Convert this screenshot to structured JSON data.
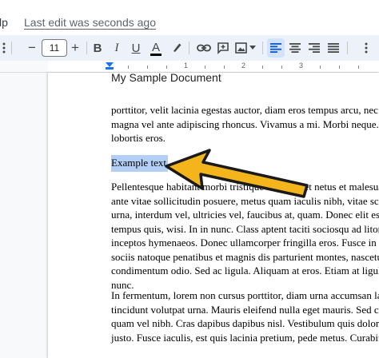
{
  "menu": {
    "help_fragment": "lp",
    "last_edit": "Last edit was seconds ago"
  },
  "toolbar": {
    "font_size": "11",
    "minus": "−",
    "plus": "+",
    "bold": "B",
    "italic": "I",
    "underline": "U",
    "text_color": "A"
  },
  "ruler": {
    "numbers": [
      "1",
      "2",
      "3"
    ]
  },
  "document": {
    "title": "My Sample Document",
    "paragraph1": [
      "porttitor, velit lacinia egestas auctor, diam eros tempus arcu, nec v",
      "magna vel ante adipiscing rhoncus. Vivamus a mi. Morbi neque. A",
      "lobortis eros."
    ],
    "selected_text": "Example text",
    "paragraph2": [
      "Pellentesque habitant morbi tristique senectus et netus et malesua",
      "ante vitae sollicitudin posuere, metus quam iaculis nibh, vitae scel",
      "urna, interdum vel, ultricies vel, faucibus at, quam. Donec elit est,",
      "tempus quis, wisi. In in nunc. Class aptent taciti sociosqu ad litora",
      "inceptos hymenaeos. Donec ullamcorper fringilla eros. Fusce in sa",
      "sociis natoque penatibus et magnis dis parturient montes, nascetur",
      "condimentum odio. Sed ac ligula. Aliquam at eros. Etiam at ligula",
      "nunc."
    ],
    "paragraph3": [
      "In fermentum, lorem non cursus porttitor, diam urna accumsan lac",
      "tincidunt volutpat urna. Mauris eleifend nulla eget mauris. Sed cr",
      "quam vel nibh. Cras dapibus dapibus nisl. Vestibulum quis dolor",
      "justo. Fusce iaculis, est quis lacinia pretium, pede metus. Curabitur n"
    ]
  },
  "colors": {
    "toolbar_bg": "#edf2fa",
    "active_align_bg": "#d3e3fd",
    "selection": "#b4cff5",
    "arrow_fill": "#f3b51b",
    "arrow_outline": "#1a1a1a"
  },
  "icons": [
    "more-vert-icon",
    "minus-icon",
    "plus-icon",
    "bold-icon",
    "italic-icon",
    "underline-icon",
    "text-color-icon",
    "highlighter-icon",
    "link-icon",
    "add-comment-icon",
    "insert-image-icon",
    "align-left-icon",
    "align-center-icon",
    "align-right-icon",
    "align-justify-icon",
    "kebab-menu-icon",
    "indent-marker-icon"
  ]
}
